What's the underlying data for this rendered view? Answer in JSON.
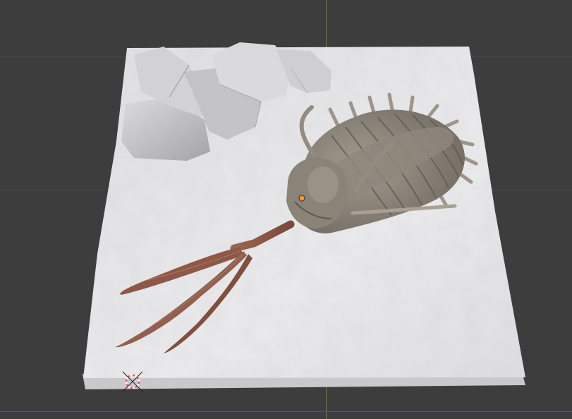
{
  "app": {
    "name": "",
    "view": "3D Viewport"
  },
  "scene": {
    "objects": [
      {
        "name": "ground-slab"
      },
      {
        "name": "rocks"
      },
      {
        "name": "trilobite"
      },
      {
        "name": "tail-appendage"
      },
      {
        "name": "3d-cursor"
      }
    ]
  },
  "colors": {
    "background": "#3d3d3d",
    "grid": "#474747",
    "x_axis": "#9a3a42",
    "y_axis": "#6b8a2c",
    "ground": "#e4e4e6",
    "rock": "#c9c9cb",
    "trilobite": "#8c8479",
    "tail": "#8a5a48",
    "origin_dot": "#ff9b1c"
  }
}
